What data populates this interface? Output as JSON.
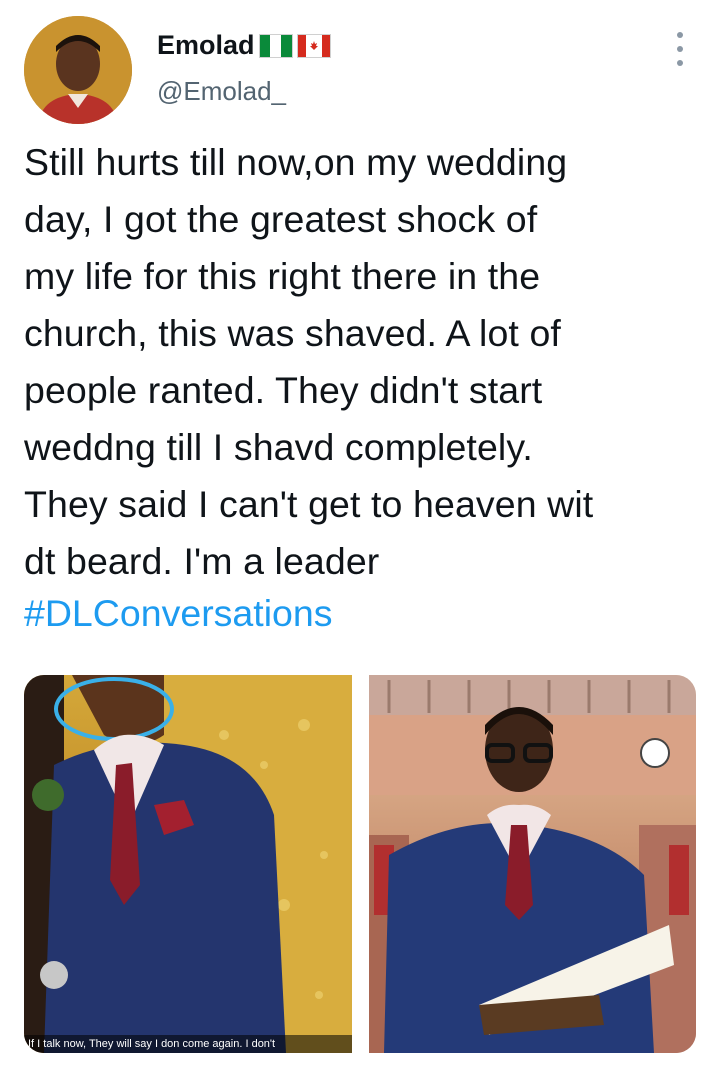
{
  "author": {
    "display_name": "Emolad",
    "handle": "@Emolad_",
    "flags": [
      {
        "name": "nigeria-flag",
        "colors": [
          "#0a8a3a",
          "#ffffff",
          "#0a8a3a"
        ]
      },
      {
        "name": "canada-flag",
        "colors": [
          "#d52b1e",
          "#ffffff",
          "#d52b1e"
        ]
      }
    ]
  },
  "tweet": {
    "text": "Still hurts till now,on my wedding\nday, I got the greatest shock of\nmy life for this right there in the\nchurch, this was shaved. A lot of\npeople ranted. They didn't start\nweddng till I shavd completely.\nThey said I can't get to heaven wit\ndt beard. I'm a leader",
    "hashtag": "#DLConversations"
  },
  "media": {
    "left_caption": "If I talk now, They will say I don come again. I don't"
  },
  "icons": {
    "more": "more-vertical-icon"
  },
  "colors": {
    "link": "#1d9bf0",
    "secondary_text": "#536471",
    "primary_text": "#0f1419"
  }
}
